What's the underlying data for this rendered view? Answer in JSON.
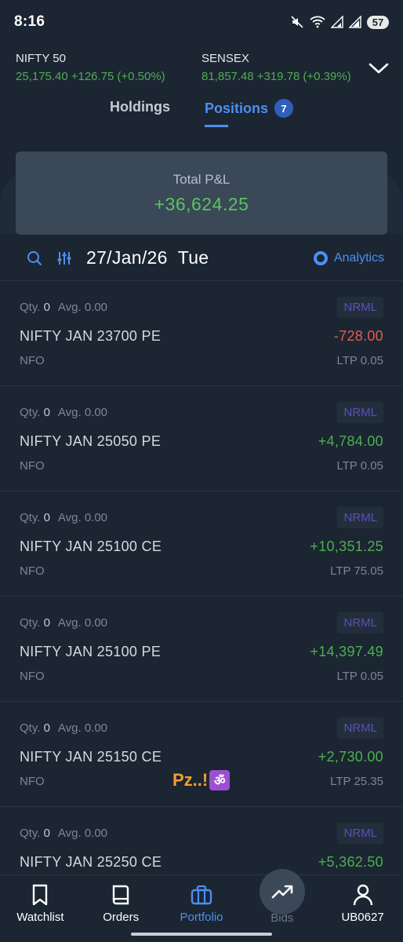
{
  "status_bar": {
    "time": "8:16",
    "battery": "57"
  },
  "indices": [
    {
      "name": "NIFTY 50",
      "value": "25,175.40",
      "change": "+126.75",
      "pct": "(+0.50%)"
    },
    {
      "name": "SENSEX",
      "value": "81,857.48",
      "change": "+319.78",
      "pct": "(+0.39%)"
    }
  ],
  "tabs": [
    {
      "label": "Holdings",
      "active": false
    },
    {
      "label": "Positions",
      "active": true,
      "count": "7"
    }
  ],
  "summary": {
    "label": "Total P&L",
    "value": "+36,624.25"
  },
  "toolbar": {
    "date": "27/Jan/26",
    "day": "Tue",
    "analytics_label": "Analytics"
  },
  "positions": [
    {
      "qty_label": "Qty.",
      "qty": "0",
      "avg_label": "Avg.",
      "avg": "0.00",
      "product": "NRML",
      "symbol": "NIFTY JAN 23700 PE",
      "pnl": "-728.00",
      "pnl_sign": "negative",
      "exchange": "NFO",
      "ltp": "LTP 0.05"
    },
    {
      "qty_label": "Qty.",
      "qty": "0",
      "avg_label": "Avg.",
      "avg": "0.00",
      "product": "NRML",
      "symbol": "NIFTY JAN 25050 PE",
      "pnl": "+4,784.00",
      "pnl_sign": "positive",
      "exchange": "NFO",
      "ltp": "LTP 0.05"
    },
    {
      "qty_label": "Qty.",
      "qty": "0",
      "avg_label": "Avg.",
      "avg": "0.00",
      "product": "NRML",
      "symbol": "NIFTY JAN 25100 CE",
      "pnl": "+10,351.25",
      "pnl_sign": "positive",
      "exchange": "NFO",
      "ltp": "LTP 75.05"
    },
    {
      "qty_label": "Qty.",
      "qty": "0",
      "avg_label": "Avg.",
      "avg": "0.00",
      "product": "NRML",
      "symbol": "NIFTY JAN 25100 PE",
      "pnl": "+14,397.49",
      "pnl_sign": "positive",
      "exchange": "NFO",
      "ltp": "LTP 0.05"
    },
    {
      "qty_label": "Qty.",
      "qty": "0",
      "avg_label": "Avg.",
      "avg": "0.00",
      "product": "NRML",
      "symbol": "NIFTY JAN 25150 CE",
      "pnl": "+2,730.00",
      "pnl_sign": "positive",
      "exchange": "NFO",
      "ltp": "LTP 25.35"
    },
    {
      "qty_label": "Qty.",
      "qty": "0",
      "avg_label": "Avg.",
      "avg": "0.00",
      "product": "NRML",
      "symbol": "NIFTY JAN 25250 CE",
      "pnl": "+5,362.50",
      "pnl_sign": "positive",
      "exchange": "",
      "ltp": ""
    }
  ],
  "watermark": {
    "text": "Pz..!",
    "symbol": "ॐ"
  },
  "bottom_nav": [
    {
      "label": "Watchlist",
      "icon": "bookmark-icon"
    },
    {
      "label": "Orders",
      "icon": "book-icon"
    },
    {
      "label": "Portfolio",
      "icon": "briefcase-icon",
      "active": true
    },
    {
      "label": "Bids",
      "icon": "trend-up-icon"
    },
    {
      "label": "UB0627",
      "icon": "user-icon"
    }
  ],
  "colors": {
    "positive": "#4caf50",
    "negative": "#e35a50",
    "accent": "#4d8ff0",
    "background": "#1c2532"
  }
}
